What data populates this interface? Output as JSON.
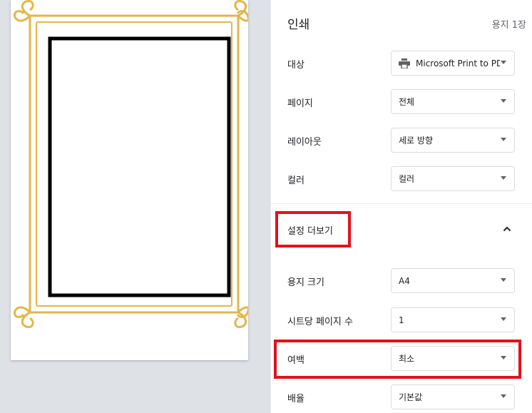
{
  "header": {
    "title": "인쇄",
    "sheet_count": "용지 1장"
  },
  "settings": {
    "destination": {
      "label": "대상",
      "value": "Microsoft Print to PDF",
      "icon": "printer-icon"
    },
    "pages": {
      "label": "페이지",
      "value": "전체"
    },
    "layout": {
      "label": "레이아웃",
      "value": "세로 방향"
    },
    "color": {
      "label": "컬러",
      "value": "컬러"
    }
  },
  "more_settings": {
    "label": "설정 더보기",
    "expanded": true,
    "icon": "chevron-up-icon"
  },
  "advanced": {
    "paper_size": {
      "label": "용지 크기",
      "value": "A4"
    },
    "pages_per_sheet": {
      "label": "시트당 페이지 수",
      "value": "1"
    },
    "margins": {
      "label": "여백",
      "value": "최소"
    },
    "scale": {
      "label": "배율",
      "value": "기본값"
    }
  },
  "colors": {
    "frame_gold": "#e2b64a",
    "highlight_red": "#e0121b",
    "preview_background": "#dee1e6"
  }
}
